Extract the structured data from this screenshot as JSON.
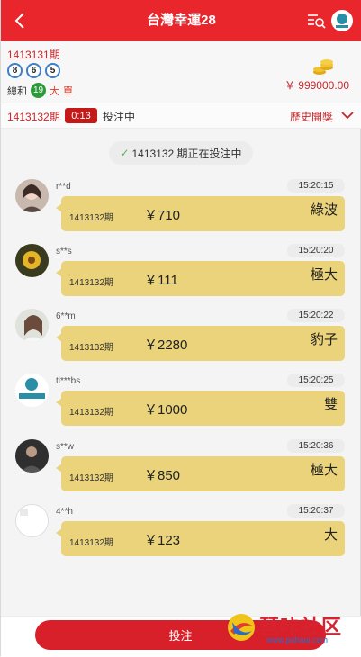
{
  "header": {
    "title": "台灣幸運28",
    "back_icon": "chevron-left-icon",
    "list_icon": "search-list-icon",
    "logo_icon": "brand-logo-icon"
  },
  "last_result": {
    "period": "1413131期",
    "balls": [
      "8",
      "6",
      "5"
    ],
    "sum_label": "總和",
    "sum_value": "19",
    "size": "大",
    "parity": "單",
    "balance": "￥ 999000.00"
  },
  "status": {
    "current_period": "1413132期",
    "countdown": "0:13",
    "state": "投注中",
    "history_label": "歷史開獎"
  },
  "notice": {
    "text": "1413132 期正在投注中"
  },
  "messages": [
    {
      "user": "r**d",
      "time": "15:20:15",
      "period": "1413132期",
      "amount": "￥710",
      "bet": "綠波"
    },
    {
      "user": "s**s",
      "time": "15:20:20",
      "period": "1413132期",
      "amount": "￥111",
      "bet": "極大"
    },
    {
      "user": "6**m",
      "time": "15:20:22",
      "period": "1413132期",
      "amount": "￥2280",
      "bet": "豹子"
    },
    {
      "user": "ti***bs",
      "time": "15:20:25",
      "period": "1413132期",
      "amount": "￥1000",
      "bet": "雙"
    },
    {
      "user": "s**w",
      "time": "15:20:36",
      "period": "1413132期",
      "amount": "￥850",
      "bet": "極大"
    },
    {
      "user": "4**h",
      "time": "15:20:37",
      "period": "1413132期",
      "amount": "￥123",
      "bet": "大"
    }
  ],
  "bottom": {
    "bet_button": "投注",
    "watermark_text": "琶咔社区",
    "watermark_url": "www.pahaui.com"
  },
  "colors": {
    "accent": "#e8262c",
    "bubble": "#ead37a",
    "ball_border": "#3e7fc7",
    "sum_ball": "#2b9a3a"
  }
}
